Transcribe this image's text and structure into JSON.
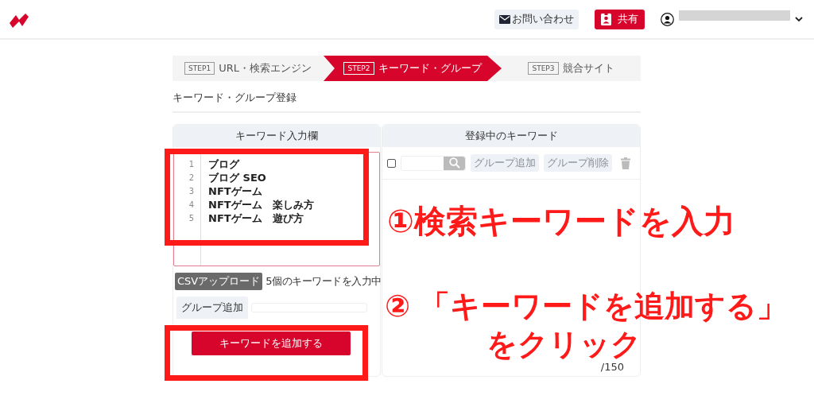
{
  "header": {
    "contact_button": "お問い合わせ",
    "share_button": "共有"
  },
  "steps": [
    {
      "badge": "STEP1",
      "label": "URL・検索エンジン",
      "selected": false
    },
    {
      "badge": "STEP2",
      "label": "キーワード・グループ",
      "selected": true
    },
    {
      "badge": "STEP3",
      "label": "競合サイト",
      "selected": false
    }
  ],
  "section_title": "キーワード・グループ登録",
  "input_panel": {
    "title": "キーワード入力欄",
    "lines": [
      {
        "number": "1",
        "text": "ブログ"
      },
      {
        "number": "2",
        "text": "ブログ SEO"
      },
      {
        "number": "3",
        "text": "NFTゲーム"
      },
      {
        "number": "4",
        "text": "NFTゲーム　楽しみ方"
      },
      {
        "number": "5",
        "text": "NFTゲーム　遊び方"
      }
    ],
    "csv_button": "CSVアップロード",
    "status": "5個のキーワードを入力中",
    "group_label": "グループ追加",
    "add_button": "キーワードを追加する"
  },
  "registered_panel": {
    "title": "登録中のキーワード",
    "select_all_checked": false,
    "buttons": [
      {
        "label": "グループ追加",
        "disabled": true
      },
      {
        "label": "グループ削除",
        "disabled": true
      }
    ],
    "counter": "/150"
  },
  "annotations": {
    "step1": "①検索キーワードを入力",
    "step2_number": "②",
    "step2_text": "「キーワードを追加する」",
    "step2_text_2": "をクリック"
  }
}
